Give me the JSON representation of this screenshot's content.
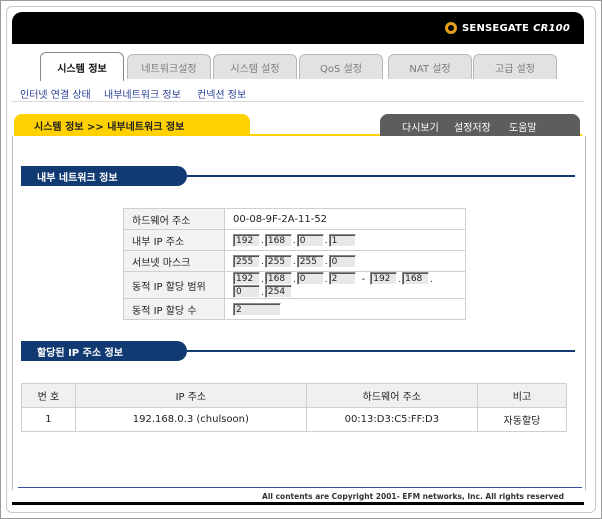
{
  "brand": {
    "name": "SENSEGATE",
    "model": "CR100"
  },
  "tabs": [
    "시스템 정보",
    "네트워크설정",
    "시스템 설정",
    "QoS 설정",
    "NAT 설정",
    "고급 설정"
  ],
  "subnav": [
    "인터넷 연결 상태",
    "내부네트워크 정보",
    "컨넥션 정보"
  ],
  "breadcrumb": "시스템 정보 >> 내부네트워크 정보",
  "actions": [
    "다시보기",
    "설정저장",
    "도움말"
  ],
  "section1": {
    "title": "내부 네트워크 정보",
    "mac_label": "하드웨어 주소",
    "mac_value": "00-08-9F-2A-11-52",
    "ip_label": "내부 IP 주소",
    "ip": [
      "192",
      "168",
      "0",
      "1"
    ],
    "mask_label": "서브넷 마스크",
    "mask": [
      "255",
      "255",
      "255",
      "0"
    ],
    "range_label": "동적 IP 할당 범위",
    "range_start": [
      "192",
      "168",
      "0",
      "2"
    ],
    "range_end": [
      "192",
      "168",
      "0",
      "254"
    ],
    "count_label": "동적 IP 할당 수",
    "count": "2"
  },
  "section2": {
    "title": "할당된 IP 주소 정보",
    "headers": [
      "번 호",
      "IP 주소",
      "하드웨어 주소",
      "비고"
    ],
    "rows": [
      [
        "1",
        "192.168.0.3 (chulsoon)",
        "00:13:D3:C5:FF:D3",
        "자동할당"
      ]
    ]
  },
  "footer": "All contents are Copyright  2001- EFM networks, Inc. All rights reserved",
  "colors": {
    "accent": "#ffd100",
    "navy": "#123a72",
    "link": "#2a3f93"
  }
}
